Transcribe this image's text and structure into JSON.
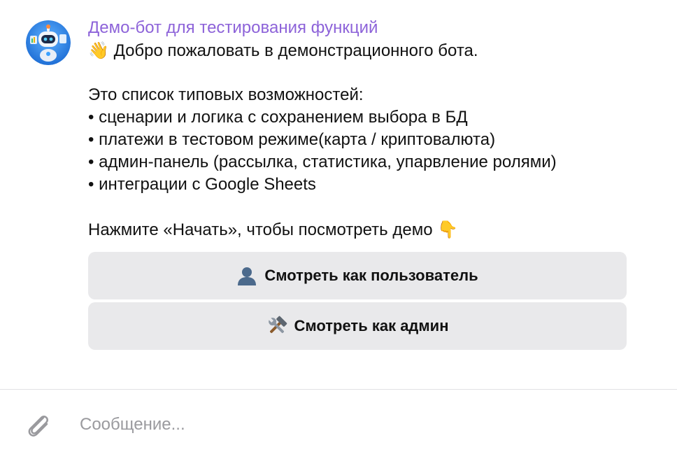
{
  "message": {
    "sender": "Демо-бот для тестирования функций",
    "greeting_emoji": "👋",
    "greeting": "Добро пожаловать в демонстрационного бота.",
    "list_intro": "Это список типовых возможностей:",
    "features": [
      "• сценарии и логика с сохранением выбора в БД",
      "• платежи в тестовом режиме(карта / криптовалюта)",
      "• админ-панель (рассылка, статистика, упарвление ролями)",
      "• интеграции с Google Sheets"
    ],
    "call_to_action": "Нажмите «Начать», чтобы посмотреть демо",
    "cta_emoji": "👇"
  },
  "keyboard": {
    "buttons": [
      {
        "icon": "user-silhouette-icon",
        "label": "Смотреть как пользователь"
      },
      {
        "icon": "hammer-wrench-icon",
        "label": "Смотреть как админ"
      }
    ]
  },
  "composer": {
    "placeholder": "Сообщение..."
  },
  "colors": {
    "sender": "#8d63d9",
    "button_bg": "#e9e9eb",
    "avatar_bg": "#2a7ce0"
  }
}
